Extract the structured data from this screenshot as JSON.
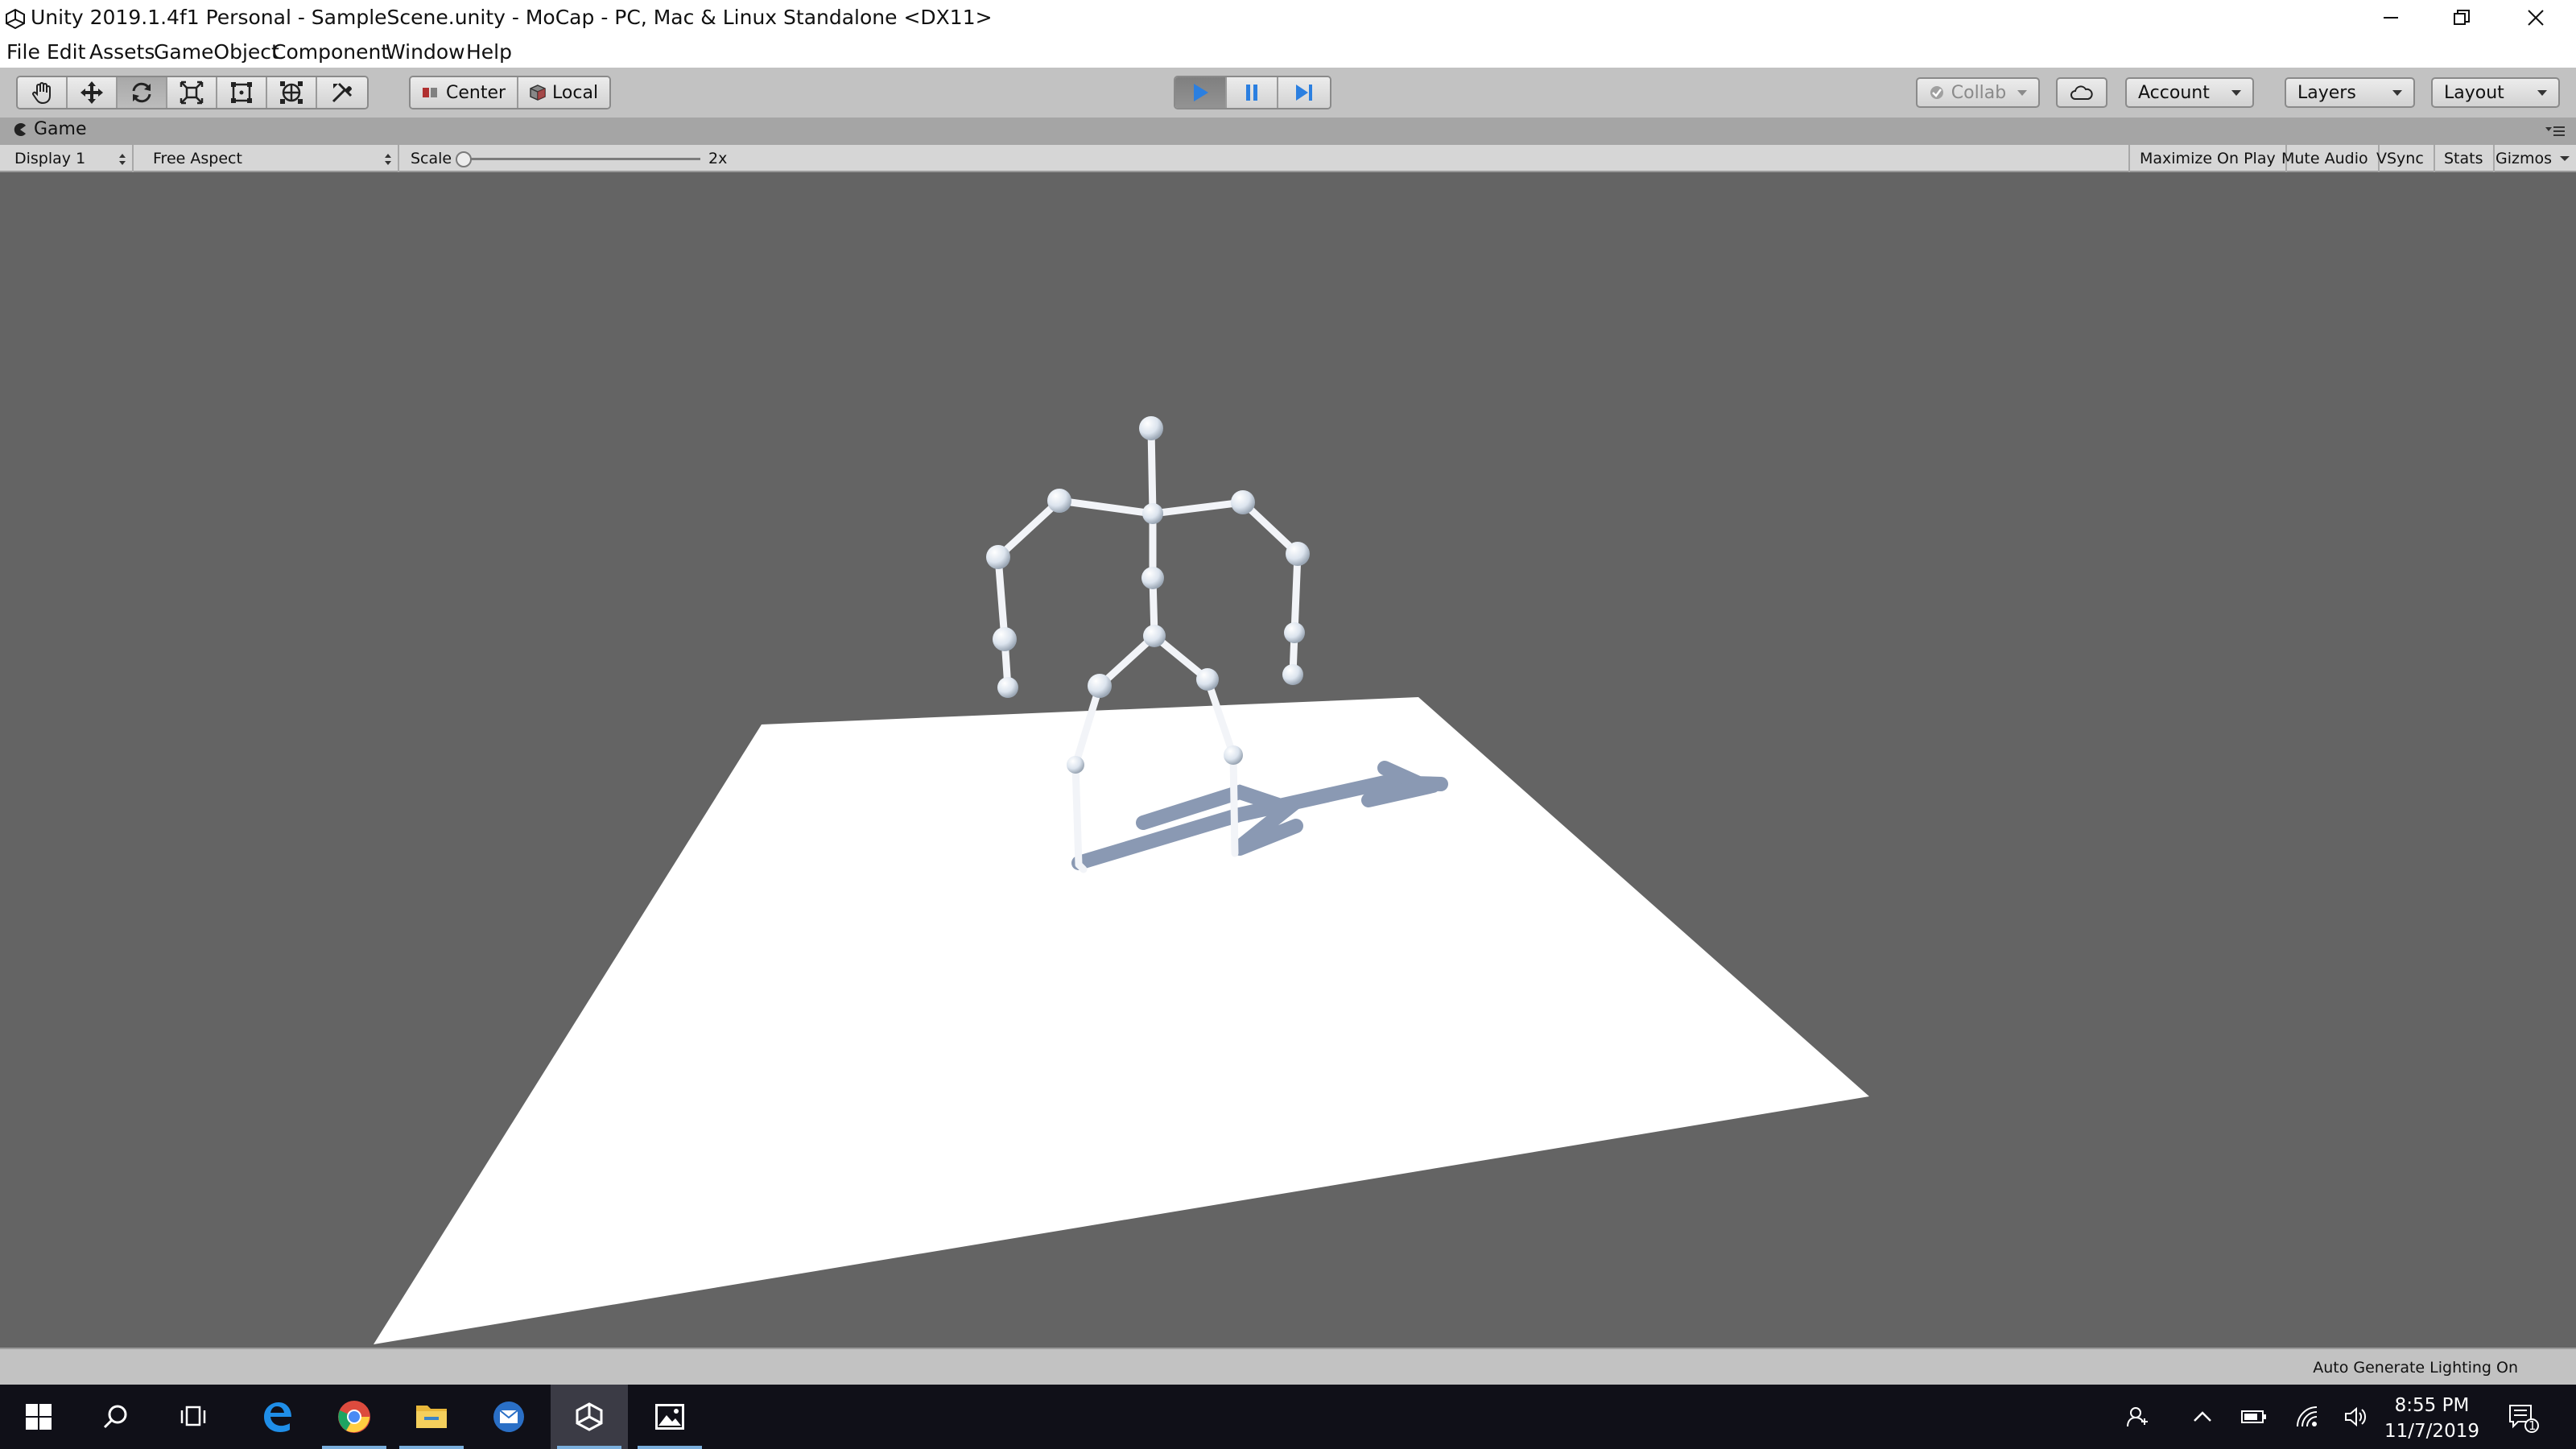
{
  "window": {
    "title": "Unity 2019.1.4f1 Personal - SampleScene.unity - MoCap - PC, Mac & Linux Standalone <DX11>"
  },
  "menu": {
    "items": [
      "File",
      "Edit",
      "Assets",
      "GameObject",
      "Component",
      "Window",
      "Help"
    ]
  },
  "toolbar": {
    "transform_tools": [
      "hand-tool",
      "move-tool",
      "rotate-tool",
      "scale-tool",
      "rect-tool",
      "transform-tool",
      "custom-tool"
    ],
    "active_tool": "rotate-tool",
    "pivot_label": "Center",
    "space_label": "Local",
    "play_active": true,
    "collab_label": "Collab",
    "account_label": "Account",
    "layers_label": "Layers",
    "layout_label": "Layout"
  },
  "game_tab": {
    "label": "Game"
  },
  "game_toolbar": {
    "display": "Display 1",
    "aspect": "Free Aspect",
    "scale_label": "Scale",
    "scale_value": "2x",
    "maximize_on_play": "Maximize On Play",
    "mute_audio": "Mute Audio",
    "vsync": "VSync",
    "stats": "Stats",
    "gizmos": "Gizmos"
  },
  "status": {
    "text": "Auto Generate Lighting On"
  },
  "taskbar": {
    "apps": [
      "start-icon",
      "search-icon",
      "task-view-icon",
      "edge-icon",
      "chrome-icon",
      "file-explorer-icon",
      "mail-icon",
      "unity-icon",
      "photos-icon"
    ],
    "time": "8:55 PM",
    "date": "11/7/2019",
    "notification_count": "1"
  },
  "colors": {
    "editor_bg": "#c2c2c2",
    "game_view_bg": "#646464",
    "play_blue": "#2b7fe0",
    "taskbar_bg": "#101018"
  }
}
